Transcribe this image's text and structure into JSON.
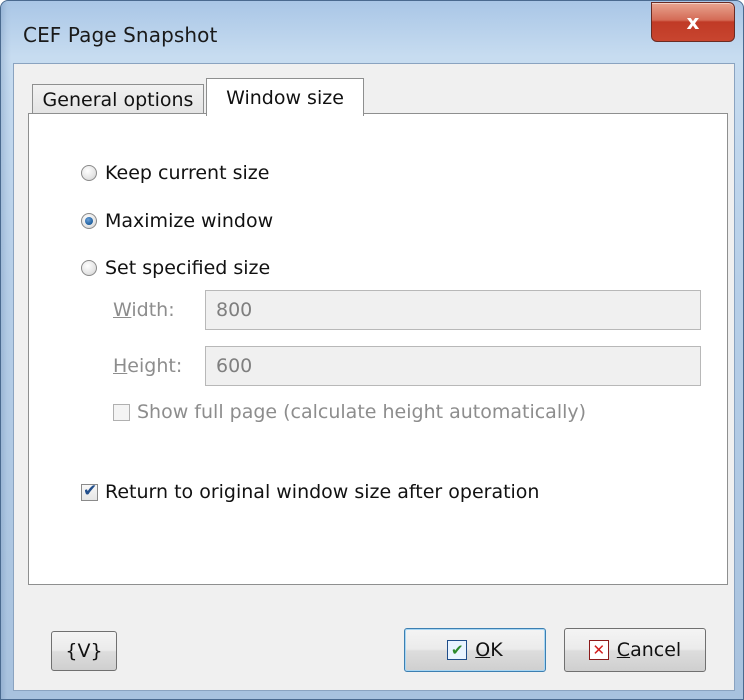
{
  "window": {
    "title": "CEF Page Snapshot",
    "close_label": "x"
  },
  "tabs": [
    {
      "label": "General options",
      "selected": false
    },
    {
      "label": "Window size",
      "selected": true
    }
  ],
  "options": {
    "keep_current_size": "Keep current size",
    "maximize_window": "Maximize window",
    "set_specified_size": "Set specified size",
    "selected": "maximize_window"
  },
  "size_fields": {
    "width_label_accel": "W",
    "width_label_rest": "idth:",
    "width_value": "800",
    "height_label_accel": "H",
    "height_label_rest": "eight:",
    "height_value": "600",
    "enabled": false
  },
  "show_full_page": {
    "label": "Show full page (calculate height automatically)",
    "checked": false,
    "enabled": false
  },
  "return_original": {
    "label": "Return to original window size after operation",
    "checked": true
  },
  "buttons": {
    "variables": "{V}",
    "ok_accel": "O",
    "ok_rest": "K",
    "cancel_accel": "C",
    "cancel_rest": "ancel"
  },
  "colors": {
    "disabled_text": "#8d8d8d",
    "radio_accent": "#1f5f9e",
    "close_red": "#c8452f"
  }
}
